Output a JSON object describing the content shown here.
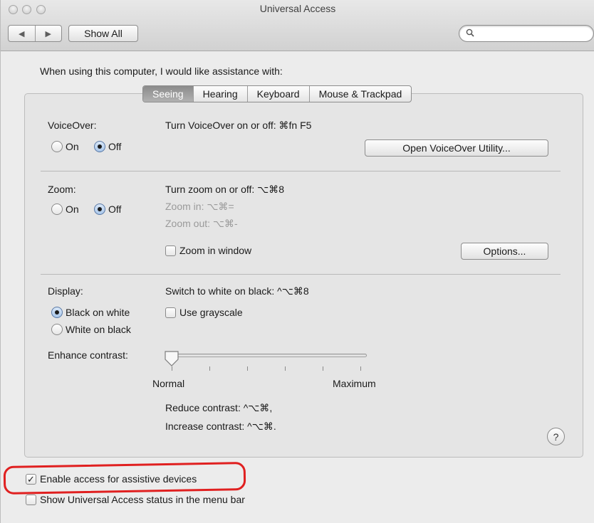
{
  "window": {
    "title": "Universal Access"
  },
  "toolbar": {
    "back_icon": "◀",
    "forward_icon": "▶",
    "show_all": "Show All",
    "search_placeholder": ""
  },
  "intro": "When using this computer, I would like assistance with:",
  "tabs": [
    {
      "label": "Seeing",
      "selected": true
    },
    {
      "label": "Hearing",
      "selected": false
    },
    {
      "label": "Keyboard",
      "selected": false
    },
    {
      "label": "Mouse & Trackpad",
      "selected": false
    }
  ],
  "voiceover": {
    "label": "VoiceOver:",
    "on": "On",
    "off": "Off",
    "selected": "Off",
    "shortcut": "Turn VoiceOver on or off: ⌘fn F5",
    "utility_button": "Open VoiceOver Utility..."
  },
  "zoom": {
    "label": "Zoom:",
    "on": "On",
    "off": "Off",
    "selected": "Off",
    "shortcut": "Turn zoom on or off: ⌥⌘8",
    "zoom_in": "Zoom in: ⌥⌘=",
    "zoom_out": "Zoom out: ⌥⌘-",
    "zoom_in_window": "Zoom in window",
    "zoom_in_window_checked": false,
    "options_button": "Options..."
  },
  "display": {
    "label": "Display:",
    "shortcut": "Switch to white on black: ^⌥⌘8",
    "black_on_white": "Black on white",
    "white_on_black": "White on black",
    "selected": "Black on white",
    "use_grayscale": "Use grayscale",
    "use_grayscale_checked": false,
    "enhance_contrast": "Enhance contrast:",
    "contrast_value": 0,
    "normal": "Normal",
    "maximum": "Maximum",
    "reduce_contrast": "Reduce contrast: ^⌥⌘,",
    "increase_contrast": "Increase contrast: ^⌥⌘."
  },
  "help": "?",
  "footer": {
    "assistive_devices": "Enable access for assistive devices",
    "assistive_devices_checked": true,
    "status_menu": "Show Universal Access status in the menu bar",
    "status_menu_checked": false,
    "highlight_color": "#e02020"
  }
}
